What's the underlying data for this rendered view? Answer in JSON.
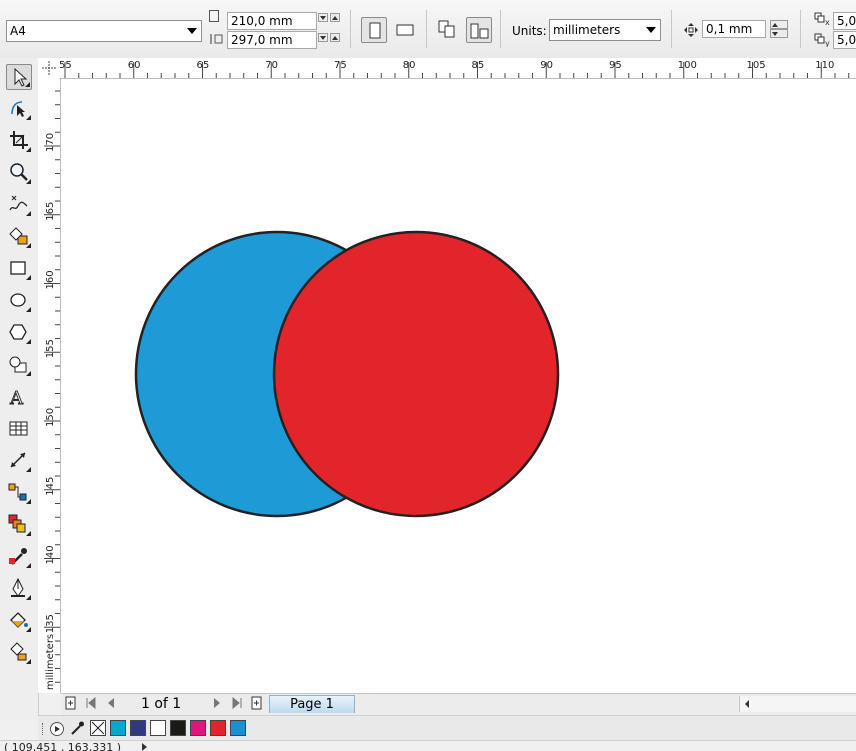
{
  "property_bar": {
    "paper_size": "A4",
    "width": "210,0 mm",
    "height": "297,0 mm",
    "units_label": "Units:",
    "units_value": "millimeters",
    "nudge": "0,1 mm",
    "dup_x": "5,0",
    "dup_y": "5,0"
  },
  "horizontal_ruler": {
    "labels": [
      "55",
      "60",
      "65",
      "70",
      "75",
      "80",
      "85",
      "90",
      "95",
      "100",
      "105",
      "110"
    ]
  },
  "vertical_ruler": {
    "labels": [
      "170",
      "165",
      "160",
      "155",
      "150",
      "145",
      "140",
      "135"
    ],
    "unit": "millimeters"
  },
  "toolbox": {
    "tools": [
      "pick-tool",
      "shape-tool",
      "crop-tool",
      "zoom-tool",
      "freehand-tool",
      "smart-fill-tool",
      "rectangle-tool",
      "ellipse-tool",
      "polygon-tool",
      "basic-shapes-tool",
      "text-tool",
      "table-tool",
      "dimension-tool",
      "connector-tool",
      "blend-tool",
      "eyedropper-tool",
      "outline-tool",
      "fill-tool",
      "interactive-fill-tool"
    ]
  },
  "canvas": {
    "shapes": [
      {
        "name": "blue-circle",
        "fill": "#1e9ad6",
        "stroke": "#222222"
      },
      {
        "name": "red-circle",
        "fill": "#e2242b",
        "stroke": "#222222"
      }
    ]
  },
  "page_nav": {
    "counter": "1 of 1",
    "tab": "Page 1"
  },
  "palette": {
    "swatches": [
      "none",
      "#00aacc",
      "#2e3a86",
      "#ffffff",
      "#1a1a1a",
      "#e0157e",
      "#e2242b",
      "#1e8fd0"
    ]
  },
  "status": {
    "coords": "( 109,451 , 163,331 )"
  }
}
